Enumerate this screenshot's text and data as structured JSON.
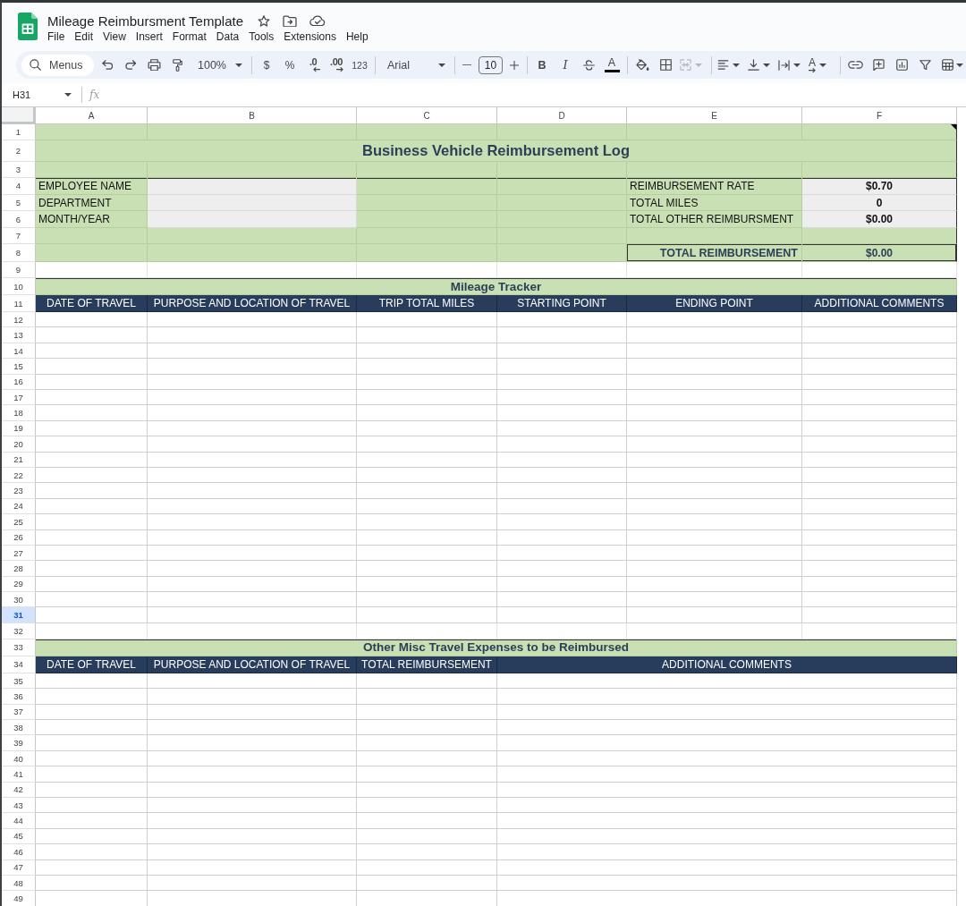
{
  "document": {
    "title": "Mileage Reimbursment Template"
  },
  "menu_bar": [
    "File",
    "Edit",
    "View",
    "Insert",
    "Format",
    "Data",
    "Tools",
    "Extensions",
    "Help"
  ],
  "toolbar": {
    "search": {
      "placeholder": "Menus"
    },
    "zoom": "100%",
    "currency": "$",
    "percent": "%",
    "decrease_decimals": ".0",
    "increase_decimals": ".00",
    "number_format": "123",
    "font": "Arial",
    "font_size": "10",
    "bold": "B",
    "italic": "I",
    "text_color": "A",
    "merge_cells": {
      "disabled": true
    },
    "text_rotation": "A"
  },
  "formula_bar": {
    "cell_reference": "H31",
    "function_label": "fx"
  },
  "columns": [
    "A",
    "B",
    "C",
    "D",
    "E",
    "F"
  ],
  "rows": [
    {
      "number": "1",
      "selected": false,
      "note": true,
      "kind": "band"
    },
    {
      "number": "2",
      "selected": false,
      "note": false,
      "kind": "title",
      "text": "Business Vehicle Reimbursement Log"
    },
    {
      "number": "3",
      "selected": false,
      "note": false,
      "kind": "band"
    },
    {
      "number": "4",
      "selected": false,
      "note": false,
      "kind": "info",
      "label": "EMPLOYEE NAME",
      "summary_label": "REIMBURSEMENT RATE",
      "summary_value": "$0.70"
    },
    {
      "number": "5",
      "selected": false,
      "note": false,
      "kind": "info",
      "label": "DEPARTMENT",
      "summary_label": "TOTAL MILES",
      "summary_value": "0"
    },
    {
      "number": "6",
      "selected": false,
      "note": false,
      "kind": "info",
      "label": "MONTH/YEAR",
      "summary_label": "TOTAL OTHER REIMBURSMENT",
      "summary_value": "$0.00"
    },
    {
      "number": "7",
      "selected": false,
      "note": false,
      "kind": "band"
    },
    {
      "number": "8",
      "selected": false,
      "note": false,
      "kind": "total",
      "summary_label": "TOTAL REIMBURSEMENT",
      "summary_value": "$0.00"
    },
    {
      "number": "9",
      "selected": false,
      "note": false,
      "kind": "blank"
    },
    {
      "number": "10",
      "selected": false,
      "note": false,
      "kind": "section",
      "text": "Mileage Tracker"
    },
    {
      "number": "11",
      "selected": false,
      "note": false,
      "kind": "header",
      "cells": [
        "DATE OF TRAVEL",
        "PURPOSE AND LOCATION OF TRAVEL",
        "TRIP TOTAL MILES",
        "STARTING POINT",
        "ENDING POINT",
        "ADDITIONAL COMMENTS"
      ]
    },
    {
      "number": "12",
      "selected": false,
      "note": false,
      "kind": "entry"
    },
    {
      "number": "13",
      "selected": false,
      "note": false,
      "kind": "entry"
    },
    {
      "number": "14",
      "selected": false,
      "note": false,
      "kind": "entry"
    },
    {
      "number": "15",
      "selected": false,
      "note": false,
      "kind": "entry"
    },
    {
      "number": "16",
      "selected": false,
      "note": false,
      "kind": "entry"
    },
    {
      "number": "17",
      "selected": false,
      "note": false,
      "kind": "entry"
    },
    {
      "number": "18",
      "selected": false,
      "note": false,
      "kind": "entry"
    },
    {
      "number": "19",
      "selected": false,
      "note": false,
      "kind": "entry"
    },
    {
      "number": "20",
      "selected": false,
      "note": false,
      "kind": "entry"
    },
    {
      "number": "21",
      "selected": false,
      "note": false,
      "kind": "entry"
    },
    {
      "number": "22",
      "selected": false,
      "note": false,
      "kind": "entry"
    },
    {
      "number": "23",
      "selected": false,
      "note": false,
      "kind": "entry"
    },
    {
      "number": "24",
      "selected": false,
      "note": false,
      "kind": "entry"
    },
    {
      "number": "25",
      "selected": false,
      "note": false,
      "kind": "entry"
    },
    {
      "number": "26",
      "selected": false,
      "note": false,
      "kind": "entry"
    },
    {
      "number": "27",
      "selected": false,
      "note": false,
      "kind": "entry"
    },
    {
      "number": "28",
      "selected": false,
      "note": false,
      "kind": "entry"
    },
    {
      "number": "29",
      "selected": false,
      "note": false,
      "kind": "entry"
    },
    {
      "number": "30",
      "selected": false,
      "note": false,
      "kind": "entry"
    },
    {
      "number": "31",
      "selected": true,
      "note": false,
      "kind": "entry"
    },
    {
      "number": "32",
      "selected": false,
      "note": false,
      "kind": "blank"
    },
    {
      "number": "33",
      "selected": false,
      "note": false,
      "kind": "section",
      "text": "Other Misc Travel Expenses to be Reimbursed"
    },
    {
      "number": "34",
      "selected": false,
      "note": false,
      "kind": "header",
      "cells": [
        "DATE OF TRAVEL",
        "PURPOSE AND LOCATION OF TRAVEL",
        "TOTAL REIMBURSEMENT",
        "ADDITIONAL COMMENTS"
      ]
    },
    {
      "number": "35",
      "selected": false,
      "note": false,
      "kind": "entry"
    },
    {
      "number": "36",
      "selected": false,
      "note": false,
      "kind": "entry"
    },
    {
      "number": "37",
      "selected": false,
      "note": false,
      "kind": "entry"
    },
    {
      "number": "38",
      "selected": false,
      "note": false,
      "kind": "entry"
    },
    {
      "number": "39",
      "selected": false,
      "note": false,
      "kind": "entry"
    },
    {
      "number": "40",
      "selected": false,
      "note": false,
      "kind": "entry"
    },
    {
      "number": "41",
      "selected": false,
      "note": false,
      "kind": "entry"
    },
    {
      "number": "42",
      "selected": false,
      "note": false,
      "kind": "entry"
    },
    {
      "number": "43",
      "selected": false,
      "note": false,
      "kind": "entry"
    },
    {
      "number": "44",
      "selected": false,
      "note": false,
      "kind": "entry"
    },
    {
      "number": "45",
      "selected": false,
      "note": false,
      "kind": "entry"
    },
    {
      "number": "46",
      "selected": false,
      "note": false,
      "kind": "entry"
    },
    {
      "number": "47",
      "selected": false,
      "note": false,
      "kind": "entry"
    },
    {
      "number": "48",
      "selected": false,
      "note": false,
      "kind": "entry"
    },
    {
      "number": "49",
      "selected": false,
      "note": false,
      "kind": "entry"
    }
  ]
}
